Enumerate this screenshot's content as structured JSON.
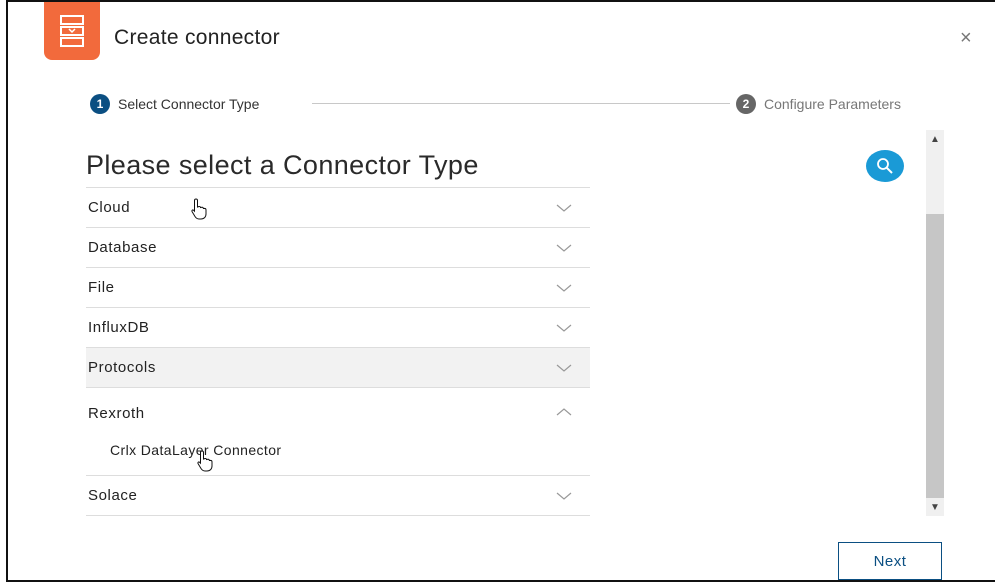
{
  "dialog": {
    "title": "Create connector",
    "close_symbol": "×",
    "logo_icon": "connector-icon",
    "accent_color": "#f26a3c"
  },
  "stepper": {
    "steps": [
      {
        "number": "1",
        "label": "Select Connector Type",
        "active": true
      },
      {
        "number": "2",
        "label": "Configure Parameters",
        "active": false
      }
    ]
  },
  "main": {
    "heading": "Please select a Connector Type",
    "search_icon": "search-icon",
    "categories": [
      {
        "label": "Cloud",
        "expanded": false
      },
      {
        "label": "Database",
        "expanded": false
      },
      {
        "label": "File",
        "expanded": false
      },
      {
        "label": "InfluxDB",
        "expanded": false
      },
      {
        "label": "Protocols",
        "expanded": false,
        "hovered": true
      },
      {
        "label": "Rexroth",
        "expanded": true,
        "children": [
          "Crlx DataLayer Connector"
        ]
      },
      {
        "label": "Solace",
        "expanded": false
      }
    ]
  },
  "footer": {
    "next_label": "Next"
  },
  "colors": {
    "primary": "#0b4f82",
    "search": "#1a9ad6"
  }
}
